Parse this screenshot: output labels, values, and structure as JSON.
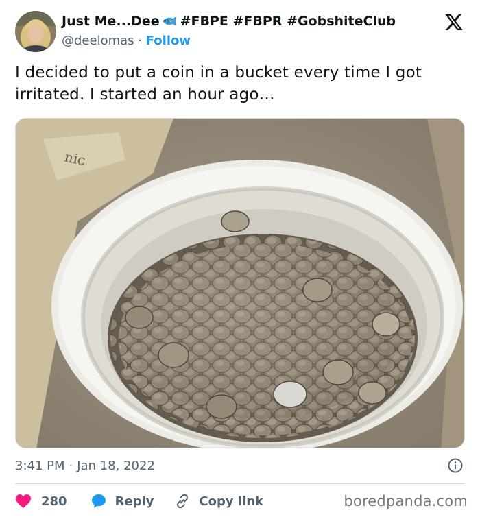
{
  "author": {
    "display_name": "Just Me...Dee",
    "hashtags": "#FBPE #FBPR #GobshiteClub",
    "handle": "@deelomas",
    "separator": "·",
    "follow_label": "Follow"
  },
  "tweet": {
    "text": "I decided to put a coin in a bucket every time I got irritated. I started an hour ago…"
  },
  "meta": {
    "time": "3:41 PM",
    "separator": "·",
    "date": "Jan 18, 2022"
  },
  "actions": {
    "likes": "280",
    "reply_label": "Reply",
    "copy_label": "Copy link"
  },
  "watermark": "boredpanda.com",
  "colors": {
    "accent": "#1d9bf0",
    "like": "#f91880",
    "muted": "#536471",
    "text": "#0f1419"
  },
  "icons": [
    "fish-emoji-icon",
    "x-logo-icon",
    "info-icon",
    "heart-icon",
    "reply-bubble-icon",
    "link-icon"
  ]
}
